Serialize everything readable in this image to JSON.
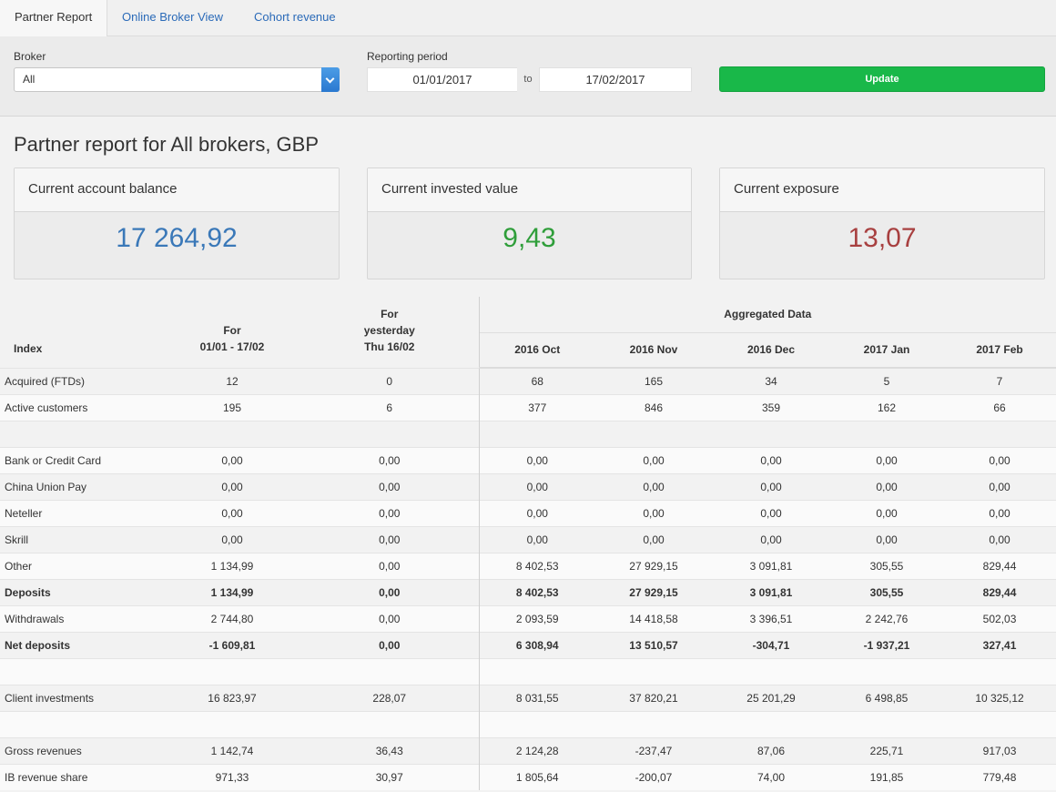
{
  "tabs": [
    {
      "label": "Partner Report",
      "active": true
    },
    {
      "label": "Online Broker View",
      "active": false
    },
    {
      "label": "Cohort revenue",
      "active": false
    }
  ],
  "filters": {
    "broker_label": "Broker",
    "broker_value": "All",
    "period_label": "Reporting period",
    "date_from": "01/01/2017",
    "to_label": "to",
    "date_to": "17/02/2017",
    "update_label": "Update"
  },
  "title": "Partner report for All brokers, GBP",
  "cards": [
    {
      "label": "Current account balance",
      "value": "17 264,92",
      "color": "#3a78b8"
    },
    {
      "label": "Current invested value",
      "value": "9,43",
      "color": "#2f9e3a"
    },
    {
      "label": "Current exposure",
      "value": "13,07",
      "color": "#a84040"
    }
  ],
  "colors": {
    "update_button": "#19b849",
    "link": "#2a6ab8"
  },
  "table": {
    "index_header": "Index",
    "for_header": [
      "For",
      "01/01 - 17/02"
    ],
    "yesterday_header": [
      "For",
      "yesterday",
      "Thu 16/02"
    ],
    "aggregated_header": "Aggregated Data",
    "months": [
      "2016 Oct",
      "2016 Nov",
      "2016 Dec",
      "2017 Jan",
      "2017 Feb"
    ],
    "rows": [
      {
        "label": "Acquired (FTDs)",
        "period": "12",
        "yesterday": "0",
        "months": [
          "68",
          "165",
          "34",
          "5",
          "7"
        ]
      },
      {
        "label": "Active customers",
        "period": "195",
        "yesterday": "6",
        "months": [
          "377",
          "846",
          "359",
          "162",
          "66"
        ]
      },
      {
        "blank": true
      },
      {
        "label": "Bank or Credit Card",
        "period": "0,00",
        "yesterday": "0,00",
        "months": [
          "0,00",
          "0,00",
          "0,00",
          "0,00",
          "0,00"
        ]
      },
      {
        "label": "China Union Pay",
        "period": "0,00",
        "yesterday": "0,00",
        "months": [
          "0,00",
          "0,00",
          "0,00",
          "0,00",
          "0,00"
        ]
      },
      {
        "label": "Neteller",
        "period": "0,00",
        "yesterday": "0,00",
        "months": [
          "0,00",
          "0,00",
          "0,00",
          "0,00",
          "0,00"
        ]
      },
      {
        "label": "Skrill",
        "period": "0,00",
        "yesterday": "0,00",
        "months": [
          "0,00",
          "0,00",
          "0,00",
          "0,00",
          "0,00"
        ]
      },
      {
        "label": "Other",
        "period": "1 134,99",
        "yesterday": "0,00",
        "months": [
          "8 402,53",
          "27 929,15",
          "3 091,81",
          "305,55",
          "829,44"
        ]
      },
      {
        "label": "Deposits",
        "bold": true,
        "period": "1 134,99",
        "yesterday": "0,00",
        "months": [
          "8 402,53",
          "27 929,15",
          "3 091,81",
          "305,55",
          "829,44"
        ]
      },
      {
        "label": "Withdrawals",
        "period": "2 744,80",
        "yesterday": "0,00",
        "months": [
          "2 093,59",
          "14 418,58",
          "3 396,51",
          "2 242,76",
          "502,03"
        ]
      },
      {
        "label": "Net deposits",
        "bold": true,
        "period": "-1 609,81",
        "yesterday": "0,00",
        "months": [
          "6 308,94",
          "13 510,57",
          "-304,71",
          "-1 937,21",
          "327,41"
        ]
      },
      {
        "blank": true
      },
      {
        "label": "Client investments",
        "period": "16 823,97",
        "yesterday": "228,07",
        "months": [
          "8 031,55",
          "37 820,21",
          "25 201,29",
          "6 498,85",
          "10 325,12"
        ]
      },
      {
        "blank": true
      },
      {
        "label": "Gross revenues",
        "period": "1 142,74",
        "yesterday": "36,43",
        "months": [
          "2 124,28",
          "-237,47",
          "87,06",
          "225,71",
          "917,03"
        ]
      },
      {
        "label": "IB revenue share",
        "period": "971,33",
        "yesterday": "30,97",
        "months": [
          "1 805,64",
          "-200,07",
          "74,00",
          "191,85",
          "779,48"
        ]
      }
    ]
  }
}
